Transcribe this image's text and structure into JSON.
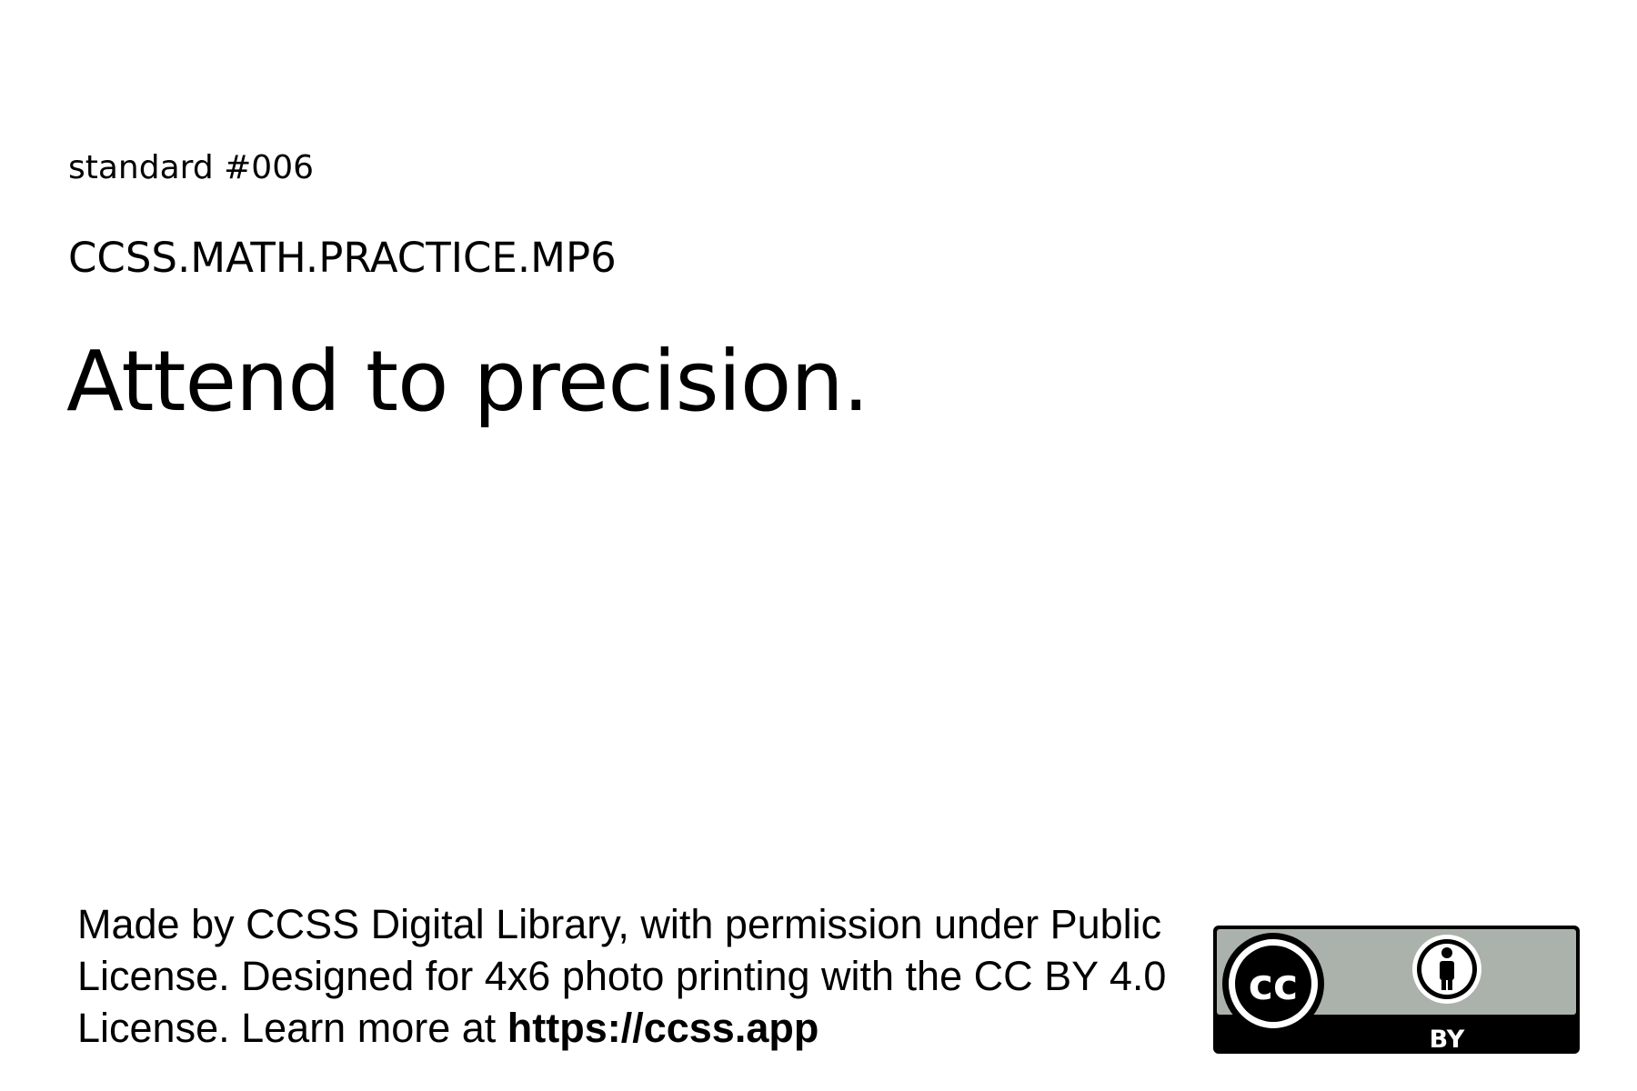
{
  "card": {
    "standard_number": "standard #006",
    "standard_code": "CCSS.MATH.PRACTICE.MP6",
    "standard_text": "Attend to precision."
  },
  "footer": {
    "attribution_text": "Made by CCSS Digital Library, with permission under Public License. Designed for 4x6 photo printing with the CC BY 4.0 License. Learn more at ",
    "attribution_url": "https://ccss.app",
    "badge": {
      "icon": "cc-by-license-icon",
      "cc_label": "cc",
      "by_label": "BY",
      "colors": {
        "badge_fill": "#aab2ab",
        "badge_border": "#000000",
        "band": "#000000",
        "band_text": "#ffffff"
      }
    }
  }
}
